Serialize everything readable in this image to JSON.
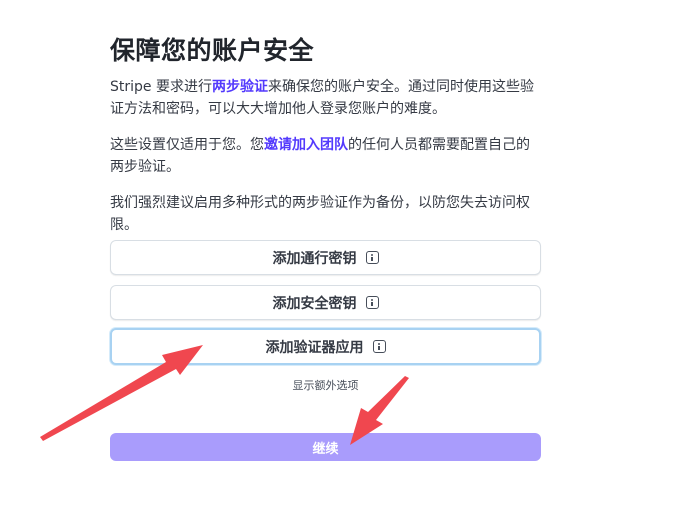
{
  "page": {
    "title": "保障您的账户安全",
    "para1": {
      "pre": "Stripe 要求进行",
      "link": "两步验证",
      "post": "来确保您的账户安全。通过同时使用这些验证方法和密码，可以大大增加他人登录您账户的难度。"
    },
    "para2": {
      "pre": "这些设置仅适用于您。您",
      "link": "邀请加入团队",
      "post": "的任何人员都需要配置自己的两步验证。"
    },
    "para3": "我们强烈建议启用多种形式的两步验证作为备份，以防您失去访问权限。"
  },
  "buttons": {
    "passkey": "添加通行密钥",
    "security_key": "添加安全密钥",
    "authenticator": "添加验证器应用"
  },
  "icons": {
    "info": "info-icon"
  },
  "more_options": "显示额外选项",
  "continue_label": "继续",
  "colors": {
    "link": "#533afd",
    "continue_bg": "#a99cfc",
    "annotation_arrow": "#f0474f",
    "focus_ring": "#a8d2f2"
  }
}
